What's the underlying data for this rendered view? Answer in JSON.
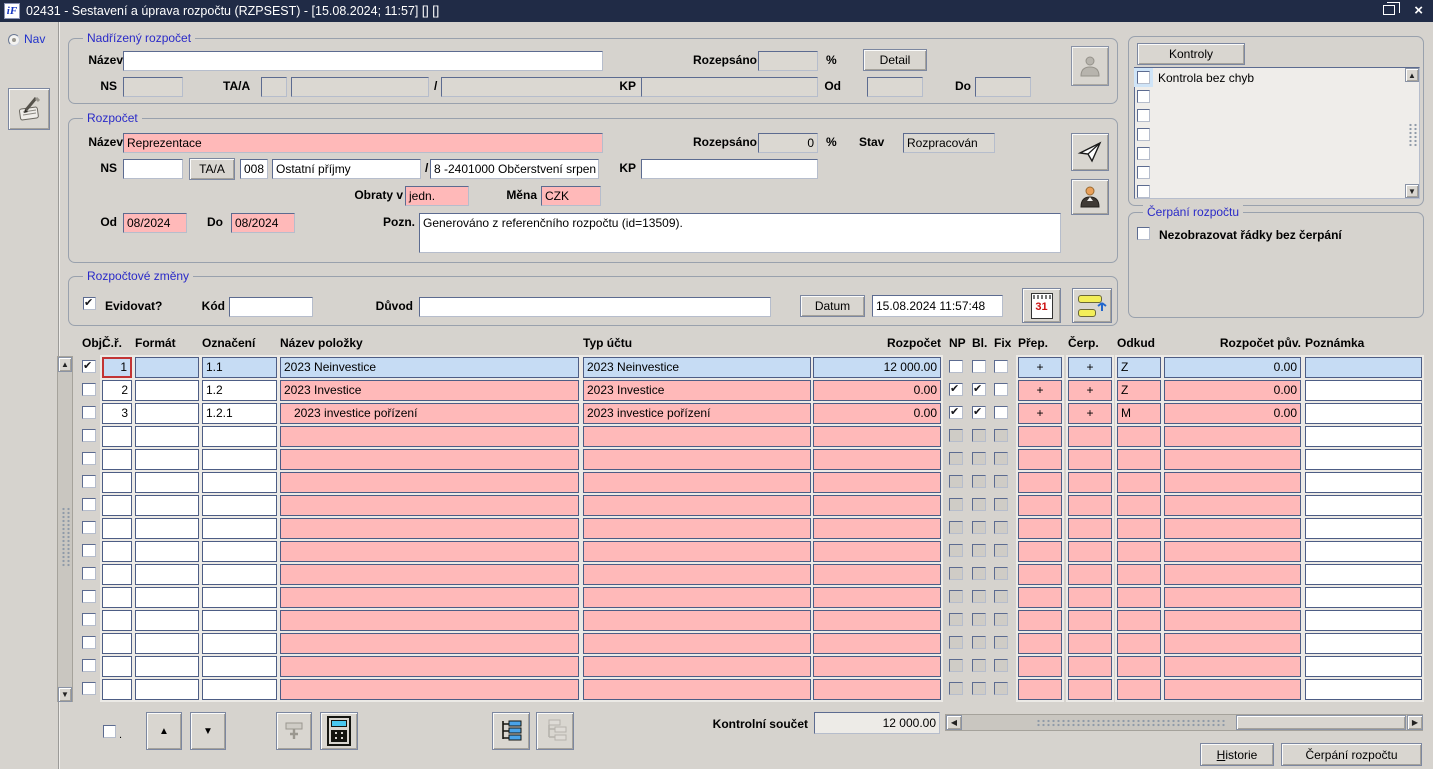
{
  "window": {
    "title": "02431 - Sestavení a úprava rozpočtu (RZPSEST) - [15.08.2024; 11:57]  [] []"
  },
  "sidebar": {
    "nav_label": "Nav"
  },
  "parent_budget": {
    "legend": "Nadřízený rozpočet",
    "nazev_label": "Název",
    "nazev_value": "",
    "ns_label": "NS",
    "ns_value": "",
    "taa_label": "TA/A",
    "taa_code": "",
    "taa_name": "",
    "slash": "/",
    "account": "",
    "kp_label": "KP",
    "kp_value": "",
    "rozepsano_label": "Rozepsáno",
    "rozepsano_value": "",
    "percent": "%",
    "detail_button": "Detail",
    "od_label": "Od",
    "od_value": "",
    "do_label": "Do",
    "do_value": ""
  },
  "budget": {
    "legend": "Rozpočet",
    "nazev_label": "Název",
    "nazev_value": "Reprezentace",
    "ns_label": "NS",
    "ns_value": "",
    "taa_button": "TA/A",
    "taa_code": "008",
    "taa_name": "Ostatní příjmy",
    "slash": "/",
    "account": "8 -2401000 Občerstvení srpen",
    "kp_label": "KP",
    "kp_value": "",
    "rozepsano_label": "Rozepsáno",
    "rozepsano_value": "0",
    "percent": "%",
    "stav_label": "Stav",
    "stav_value": "Rozpracován",
    "obraty_label": "Obraty v",
    "obraty_value": "jedn.",
    "mena_label": "Měna",
    "mena_value": "CZK",
    "od_label": "Od",
    "od_value": "08/2024",
    "do_label": "Do",
    "do_value": "08/2024",
    "pozn_label": "Pozn.",
    "pozn_value": "Generováno z referenčního rozpočtu (id=13509)."
  },
  "changes": {
    "legend": "Rozpočtové změny",
    "evidovat_label": "Evidovat?",
    "evidovat_checked": true,
    "kod_label": "Kód",
    "kod_value": "",
    "duvod_label": "Důvod",
    "duvod_value": "",
    "datum_button": "Datum",
    "datum_value": "15.08.2024 11:57:48"
  },
  "kontroly": {
    "button": "Kontroly",
    "items": [
      {
        "label": "Kontrola bez chyb",
        "checked": false,
        "selected": true
      },
      {
        "label": "",
        "checked": false,
        "selected": false
      },
      {
        "label": "",
        "checked": false,
        "selected": false
      },
      {
        "label": "",
        "checked": false,
        "selected": false
      },
      {
        "label": "",
        "checked": false,
        "selected": false
      },
      {
        "label": "",
        "checked": false,
        "selected": false
      },
      {
        "label": "",
        "checked": false,
        "selected": false
      }
    ]
  },
  "cerpani_panel": {
    "legend": "Čerpání rozpočtu",
    "checkbox_label": "Nezobrazovat řádky bez čerpání",
    "checked": false
  },
  "table": {
    "headers": {
      "obj": "Obj.",
      "cr": "Č.ř.",
      "format": "Formát",
      "oznaceni": "Označení",
      "nazev": "Název položky",
      "typ": "Typ účtu",
      "rozpocet": "Rozpočet",
      "np": "NP",
      "bl": "Bl.",
      "fix": "Fix",
      "prep": "Přep.",
      "cerp": "Čerp.",
      "odkud": "Odkud",
      "rozpocet_puv": "Rozpočet pův.",
      "poznamka": "Poznámka"
    },
    "rows": [
      {
        "obj": true,
        "cr": "1",
        "format": "",
        "oznaceni": "1.1",
        "nazev": "2023 Neinvestice",
        "typ": "2023 Neinvestice",
        "rozpocet": "12 000.00",
        "np": false,
        "bl": false,
        "fix": false,
        "prep": "+",
        "cerp": "+",
        "odkud": "Z",
        "rozpocet_puv": "0.00",
        "poznamka": "",
        "state": "selected"
      },
      {
        "obj": false,
        "cr": "2",
        "format": "",
        "oznaceni": "1.2",
        "nazev": "2023 Investice",
        "typ": "2023 Investice",
        "rozpocet": "0.00",
        "np": true,
        "bl": true,
        "fix": false,
        "prep": "+",
        "cerp": "+",
        "odkud": "Z",
        "rozpocet_puv": "0.00",
        "poznamka": "",
        "state": "filled"
      },
      {
        "obj": false,
        "cr": "3",
        "format": "",
        "oznaceni": "1.2.1",
        "nazev": "   2023 investice pořízení",
        "typ": "2023 investice pořízení",
        "rozpocet": "0.00",
        "np": true,
        "bl": true,
        "fix": false,
        "prep": "+",
        "cerp": "+",
        "odkud": "M",
        "rozpocet_puv": "0.00",
        "poznamka": "",
        "state": "filled"
      },
      {
        "obj": false,
        "cr": "",
        "format": "",
        "oznaceni": "",
        "nazev": "",
        "typ": "",
        "rozpocet": "",
        "np": false,
        "bl": false,
        "fix": false,
        "prep": "",
        "cerp": "",
        "odkud": "",
        "rozpocet_puv": "",
        "poznamka": "",
        "state": "empty"
      },
      {
        "obj": false,
        "cr": "",
        "format": "",
        "oznaceni": "",
        "nazev": "",
        "typ": "",
        "rozpocet": "",
        "np": false,
        "bl": false,
        "fix": false,
        "prep": "",
        "cerp": "",
        "odkud": "",
        "rozpocet_puv": "",
        "poznamka": "",
        "state": "empty"
      },
      {
        "obj": false,
        "cr": "",
        "format": "",
        "oznaceni": "",
        "nazev": "",
        "typ": "",
        "rozpocet": "",
        "np": false,
        "bl": false,
        "fix": false,
        "prep": "",
        "cerp": "",
        "odkud": "",
        "rozpocet_puv": "",
        "poznamka": "",
        "state": "empty"
      },
      {
        "obj": false,
        "cr": "",
        "format": "",
        "oznaceni": "",
        "nazev": "",
        "typ": "",
        "rozpocet": "",
        "np": false,
        "bl": false,
        "fix": false,
        "prep": "",
        "cerp": "",
        "odkud": "",
        "rozpocet_puv": "",
        "poznamka": "",
        "state": "empty"
      },
      {
        "obj": false,
        "cr": "",
        "format": "",
        "oznaceni": "",
        "nazev": "",
        "typ": "",
        "rozpocet": "",
        "np": false,
        "bl": false,
        "fix": false,
        "prep": "",
        "cerp": "",
        "odkud": "",
        "rozpocet_puv": "",
        "poznamka": "",
        "state": "empty"
      },
      {
        "obj": false,
        "cr": "",
        "format": "",
        "oznaceni": "",
        "nazev": "",
        "typ": "",
        "rozpocet": "",
        "np": false,
        "bl": false,
        "fix": false,
        "prep": "",
        "cerp": "",
        "odkud": "",
        "rozpocet_puv": "",
        "poznamka": "",
        "state": "empty"
      },
      {
        "obj": false,
        "cr": "",
        "format": "",
        "oznaceni": "",
        "nazev": "",
        "typ": "",
        "rozpocet": "",
        "np": false,
        "bl": false,
        "fix": false,
        "prep": "",
        "cerp": "",
        "odkud": "",
        "rozpocet_puv": "",
        "poznamka": "",
        "state": "empty"
      },
      {
        "obj": false,
        "cr": "",
        "format": "",
        "oznaceni": "",
        "nazev": "",
        "typ": "",
        "rozpocet": "",
        "np": false,
        "bl": false,
        "fix": false,
        "prep": "",
        "cerp": "",
        "odkud": "",
        "rozpocet_puv": "",
        "poznamka": "",
        "state": "empty"
      },
      {
        "obj": false,
        "cr": "",
        "format": "",
        "oznaceni": "",
        "nazev": "",
        "typ": "",
        "rozpocet": "",
        "np": false,
        "bl": false,
        "fix": false,
        "prep": "",
        "cerp": "",
        "odkud": "",
        "rozpocet_puv": "",
        "poznamka": "",
        "state": "empty"
      },
      {
        "obj": false,
        "cr": "",
        "format": "",
        "oznaceni": "",
        "nazev": "",
        "typ": "",
        "rozpocet": "",
        "np": false,
        "bl": false,
        "fix": false,
        "prep": "",
        "cerp": "",
        "odkud": "",
        "rozpocet_puv": "",
        "poznamka": "",
        "state": "empty"
      },
      {
        "obj": false,
        "cr": "",
        "format": "",
        "oznaceni": "",
        "nazev": "",
        "typ": "",
        "rozpocet": "",
        "np": false,
        "bl": false,
        "fix": false,
        "prep": "",
        "cerp": "",
        "odkud": "",
        "rozpocet_puv": "",
        "poznamka": "",
        "state": "empty"
      },
      {
        "obj": false,
        "cr": "",
        "format": "",
        "oznaceni": "",
        "nazev": "",
        "typ": "",
        "rozpocet": "",
        "np": false,
        "bl": false,
        "fix": false,
        "prep": "",
        "cerp": "",
        "odkud": "",
        "rozpocet_puv": "",
        "poznamka": "",
        "state": "empty"
      }
    ]
  },
  "footer": {
    "kontrolni_soucet_label": "Kontrolní součet",
    "kontrolni_soucet_value": "12 000.00",
    "small_dot": ".",
    "historie_button": "Historie",
    "cerpani_button": "Čerpání rozpočtu"
  },
  "colors": {
    "titlebar": "#202b46",
    "field_pink": "#ffb9b9",
    "selected_row_blue": "#c6dcf4",
    "group_title_blue": "#2a2ac8",
    "window_grey": "#d6d3ce"
  }
}
